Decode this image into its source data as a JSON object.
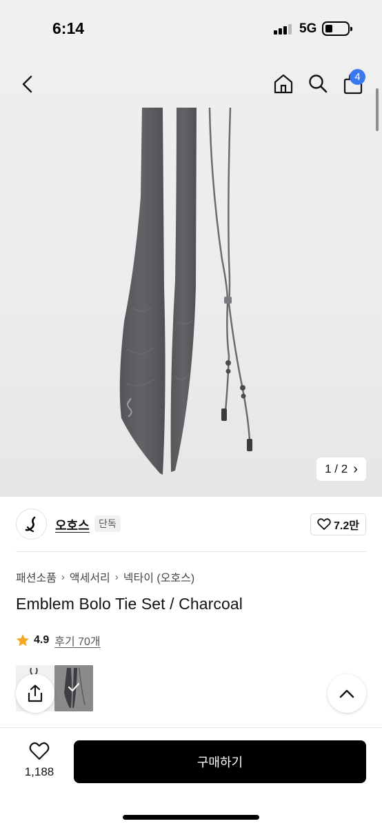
{
  "status_bar": {
    "time": "6:14",
    "network": "5G"
  },
  "nav": {
    "cart_count": "4",
    "icons": [
      "chevron-left-icon",
      "home-icon",
      "search-icon",
      "shopping-bag-icon"
    ]
  },
  "gallery": {
    "current": "1",
    "separator": "/",
    "total": "2",
    "next_arrow": "›"
  },
  "brand": {
    "name": "오호스",
    "badge": "단독",
    "likes": "7.2만"
  },
  "breadcrumb": {
    "items": [
      "패션소품",
      "액세서리",
      "넥타이 (오호스)"
    ],
    "separator": "›"
  },
  "product": {
    "title": "Emblem Bolo Tie Set / Charcoal",
    "rating": "4.9",
    "review_link": "후기 70개"
  },
  "bottom_bar": {
    "wishlist_count": "1,188",
    "buy_label": "구매하기"
  },
  "colors": {
    "accent_badge": "#3a78f2",
    "star": "#f5a623",
    "buy_button": "#000000",
    "product_charcoal": "#5c5c5e"
  }
}
